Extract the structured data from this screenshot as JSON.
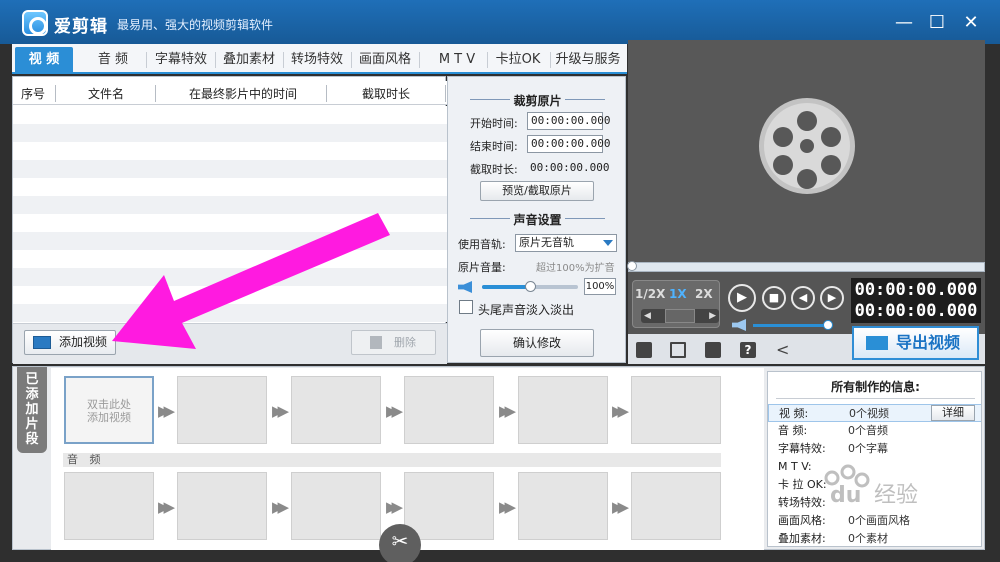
{
  "app": {
    "name": "爱剪辑",
    "slogan": "最易用、强大的视频剪辑软件"
  },
  "window_controls": {
    "minimize": "—",
    "maximize": "☐",
    "close": "✕"
  },
  "tabs": [
    {
      "label": "视 频",
      "active": true
    },
    {
      "label": "音 频"
    },
    {
      "label": "字幕特效"
    },
    {
      "label": "叠加素材"
    },
    {
      "label": "转场特效"
    },
    {
      "label": "画面风格"
    },
    {
      "label": "M T V"
    },
    {
      "label": "卡拉OK"
    },
    {
      "label": "升级与服务"
    }
  ],
  "file_list": {
    "columns": [
      "序号",
      "文件名",
      "在最终影片中的时间",
      "截取时长"
    ],
    "rows": [],
    "add_button": "添加视频",
    "delete_button": "删除"
  },
  "clip_settings": {
    "crop_title": "裁剪原片",
    "start_label": "开始时间:",
    "start_value": "00:00:00.000",
    "end_label": "结束时间:",
    "end_value": "00:00:00.000",
    "duration_label": "截取时长:",
    "duration_value": "00:00:00.000",
    "preview_button": "预览/截取原片",
    "sound_title": "声音设置",
    "track_label": "使用音轨:",
    "track_value": "原片无音轨",
    "volume_label": "原片音量:",
    "volume_hint": "超过100%为扩音",
    "volume_value": "100%",
    "volume_level": 0.5,
    "fade_label": "头尾声音淡入淡出",
    "fade_checked": false,
    "confirm_button": "确认修改"
  },
  "player": {
    "speeds": [
      "1/2X",
      "1X",
      "2X"
    ],
    "active_speed": "1X",
    "current_time": "00:00:00.000",
    "total_time": "00:00:00.000",
    "volume_level": 0.95,
    "export_button": "导出视频",
    "toolbar_icons": [
      "new-project-icon",
      "open-folder-icon",
      "save-icon",
      "help-icon",
      "share-icon"
    ]
  },
  "timeline": {
    "vertical_tab": "已添加片段",
    "first_slot_text": "双击此处\n添加视频",
    "audio_label": "音 频",
    "scissors": "✂"
  },
  "info_panel": {
    "title": "所有制作的信息:",
    "rows": [
      {
        "key": "视 频:",
        "value": "0个视频"
      },
      {
        "key": "音 频:",
        "value": "0个音频"
      },
      {
        "key": "字幕特效:",
        "value": "0个字幕"
      },
      {
        "key": "M T V:",
        "value": ""
      },
      {
        "key": "卡 拉 OK:",
        "value": ""
      },
      {
        "key": "转场特效:",
        "value": ""
      },
      {
        "key": "画面风格:",
        "value": "0个画面风格"
      },
      {
        "key": "叠加素材:",
        "value": "0个素材"
      }
    ],
    "detail_button": "详细"
  },
  "watermark": "经验",
  "colors": {
    "accent": "#2b8ed6",
    "annotation": "#ff1ae0",
    "titlebar": "#1f6fb8"
  }
}
